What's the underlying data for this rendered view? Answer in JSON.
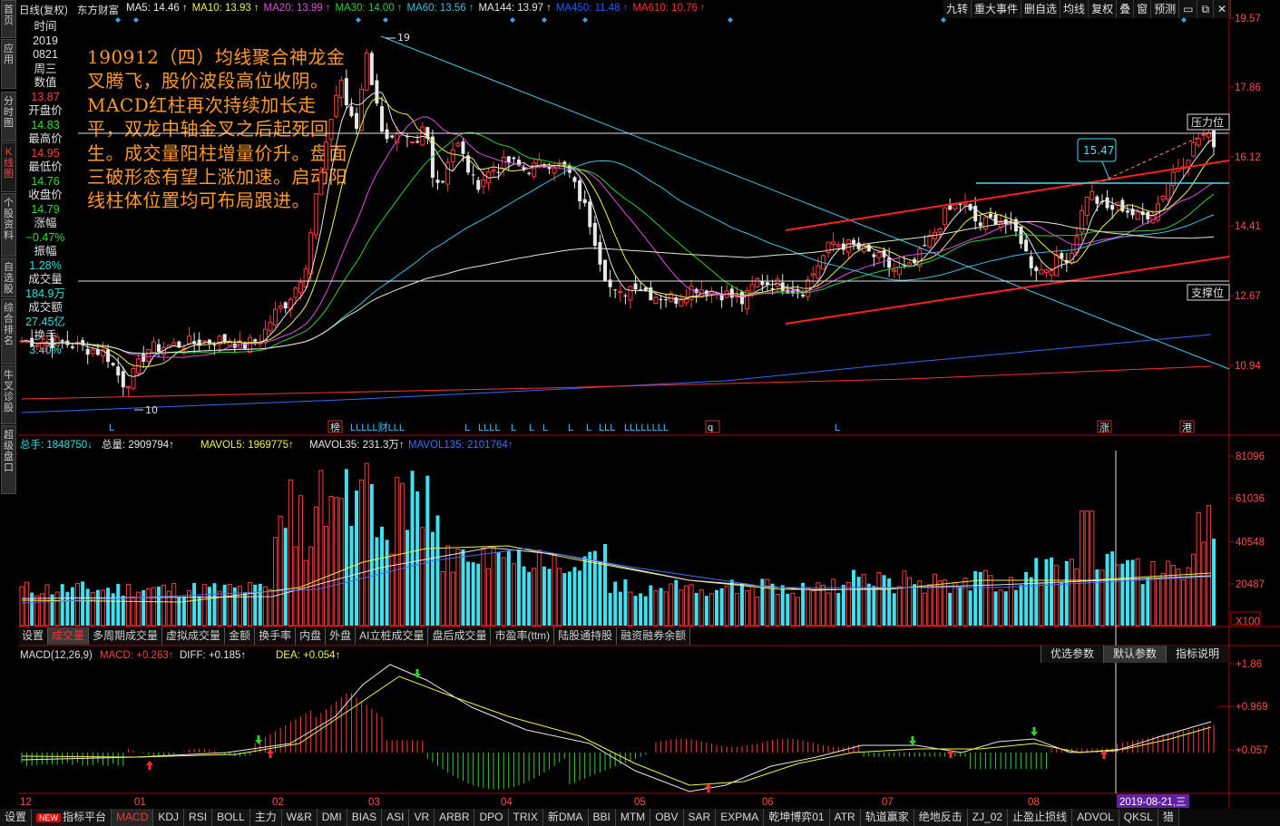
{
  "left_tabs": [
    "首页",
    "应用",
    "分时图",
    "K线图",
    "个股资料",
    "自选股",
    "综合排名",
    "牛叉诊股",
    "超级盘口"
  ],
  "active_left_tab": "K线图",
  "topbar": {
    "period": "日线(复权)",
    "stock_name": "东方财富",
    "ma_values": [
      {
        "label": "MA5: 14.46",
        "color": "#e8e8e8",
        "arrow": "↑"
      },
      {
        "label": "MA10: 13.93",
        "color": "#f2f24a",
        "arrow": "↑"
      },
      {
        "label": "MA20: 13.99",
        "color": "#e050e0",
        "arrow": "↑"
      },
      {
        "label": "MA30: 14.00",
        "color": "#30d030",
        "arrow": "↑"
      },
      {
        "label": "MA60: 13.56",
        "color": "#40c0e0",
        "arrow": "↑"
      },
      {
        "label": "MA144: 13.97",
        "color": "#e8e8e8",
        "arrow": "↑"
      },
      {
        "label": "MA450: 11.48",
        "color": "#2060ff",
        "arrow": "↑"
      },
      {
        "label": "MA610: 10.76",
        "color": "#ff3030",
        "arrow": "↑"
      }
    ],
    "buttons": [
      "九转",
      "重大事件",
      "删自选",
      "均线",
      "复权",
      "叠",
      "窗",
      "预测"
    ]
  },
  "info_panel": [
    {
      "label": "时间",
      "value": "2019",
      "value2": "0821",
      "value3": "周三"
    },
    {
      "label": "数值",
      "value": "13.87",
      "color": "#ff4040"
    },
    {
      "label": "开盘价",
      "value": "14.83",
      "color": "#30e030"
    },
    {
      "label": "最高价",
      "value": "14.95",
      "color": "#ff4040"
    },
    {
      "label": "最低价",
      "value": "14.76",
      "color": "#30e030"
    },
    {
      "label": "收盘价",
      "value": "14.79",
      "color": "#30e030"
    },
    {
      "label": "涨幅",
      "value": "−0.47%",
      "color": "#30e030"
    },
    {
      "label": "振幅",
      "value": "1.28%",
      "color": "#30e0e0"
    },
    {
      "label": "成交量",
      "value": "184.9万",
      "color": "#30e0e0"
    },
    {
      "label": "成交额",
      "value": "27.45亿",
      "color": "#30e0e0"
    },
    {
      "label": "换手",
      "value": "3.40%",
      "color": "#30e0e0"
    }
  ],
  "annotation": "190912（四）均线聚合神龙金叉腾飞，股价波段高位收阴。MACD红柱再次持续加长走平，双龙中轴金叉之后起死回生。成交量阳柱增量价升。盘面三破形态有望上涨加速。启动阳线柱体位置均可布局跟进。",
  "price_axis": [
    "19.57",
    "17.86",
    "16.12",
    "14.41",
    "12.67",
    "10.94"
  ],
  "chart_labels": {
    "high": "19",
    "low": "10",
    "price_tag": "15.47",
    "resistance": "压力位",
    "support": "支撑位"
  },
  "event_marks": [
    "L",
    "榜",
    "LLLLL财LLL",
    "L",
    "LLLL",
    "L",
    "L",
    "L",
    "L",
    "L",
    "LLL",
    "LLLLLLLL",
    "q",
    "L",
    "涨",
    "港"
  ],
  "volume_header": [
    {
      "label": "总手: 1848750↓",
      "color": "#30e0e0"
    },
    {
      "label": "总量: 2909794↑",
      "color": "#e8e8e8"
    },
    {
      "label": "MAVOL5: 1969775↑",
      "color": "#f2f24a"
    },
    {
      "label": "MAVOL35: 231.3万↑",
      "color": "#e8e8e8"
    },
    {
      "label": "MAVOL135: 2101764↑",
      "color": "#4070ff"
    }
  ],
  "volume_axis": [
    "81096",
    "61036",
    "40548",
    "20487",
    "X100"
  ],
  "volume_tabs": [
    "设置",
    "成交量",
    "多周期成交量",
    "虚拟成交量",
    "金额",
    "换手率",
    "内盘",
    "外盘",
    "AI立桩成交量",
    "盘后成交量",
    "市盈率(ttm)",
    "陆股通持股",
    "融资融券余额"
  ],
  "active_volume_tab": "成交量",
  "macd_header": [
    {
      "label": "MACD(12,26,9)",
      "color": "#e0e0e0"
    },
    {
      "label": "MACD: +0.263↑",
      "color": "#ff4040"
    },
    {
      "label": "DIFF: +0.185↑",
      "color": "#e8e8e8"
    },
    {
      "label": "DEA: +0.054↑",
      "color": "#f2f24a"
    }
  ],
  "macd_buttons": [
    "优选参数",
    "默认参数",
    "指标说明"
  ],
  "macd_axis": [
    "+1.86",
    "+0.969",
    "+0.057"
  ],
  "x_axis": [
    "12",
    "01",
    "02",
    "03",
    "04",
    "05",
    "06",
    "07",
    "08"
  ],
  "cursor_date": "2019-08-21,三",
  "bottom_tabs": [
    "设置",
    "指标平台",
    "MACD",
    "KDJ",
    "RSI",
    "BOLL",
    "主力",
    "W&R",
    "DMI",
    "BIAS",
    "ASI",
    "VR",
    "ARBR",
    "DPO",
    "TRIX",
    "新DMA",
    "BBI",
    "MTM",
    "OBV",
    "SAR",
    "EXPMA",
    "乾坤博弈01",
    "ATR",
    "轨道赢家",
    "绝地反击",
    "ZJ_02",
    "止盈止损线",
    "ADVOL",
    "QKSL",
    "猎"
  ],
  "active_bottom_tab": "MACD",
  "new_badge": "NEW"
}
